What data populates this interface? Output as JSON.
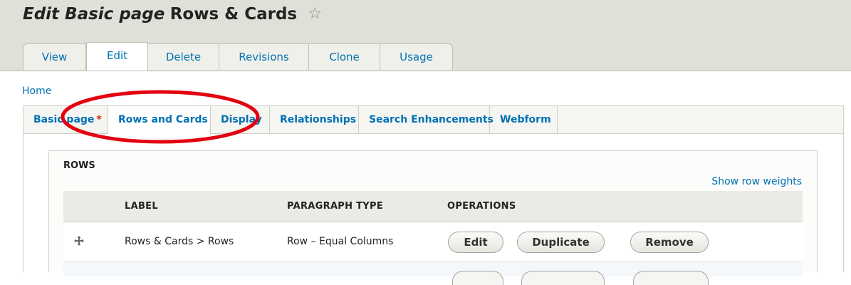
{
  "title": {
    "italic_part": "Edit Basic page",
    "plain_part": "Rows & Cards",
    "star_glyph": "☆"
  },
  "primary_tabs": [
    {
      "label": "View"
    },
    {
      "label": "Edit",
      "active": true
    },
    {
      "label": "Delete"
    },
    {
      "label": "Revisions"
    },
    {
      "label": "Clone"
    },
    {
      "label": "Usage"
    }
  ],
  "breadcrumb": {
    "home": "Home"
  },
  "secondary_tabs": [
    {
      "label": "Basic page",
      "required_mark": "*"
    },
    {
      "label": "Rows and Cards",
      "active": true
    },
    {
      "label": "Display"
    },
    {
      "label": "Relationships"
    },
    {
      "label": "Search Enhancements"
    },
    {
      "label": "Webform"
    }
  ],
  "rows_fieldset": {
    "legend": "ROWS",
    "show_weights": "Show row weights",
    "columns": [
      "LABEL",
      "PARAGRAPH TYPE",
      "OPERATIONS"
    ],
    "rows": [
      {
        "label": "Rows & Cards > Rows",
        "paragraph_type": "Row – Equal Columns",
        "operations": [
          "Edit",
          "Duplicate",
          "Remove"
        ]
      }
    ]
  },
  "colors": {
    "link": "#0071b3",
    "header_bg": "#e0e0d8",
    "annotation": "#e3000f",
    "required": "#e32700"
  },
  "icons": {
    "drag_handle": "move-arrows-icon",
    "favorite": "star-outline-icon"
  }
}
